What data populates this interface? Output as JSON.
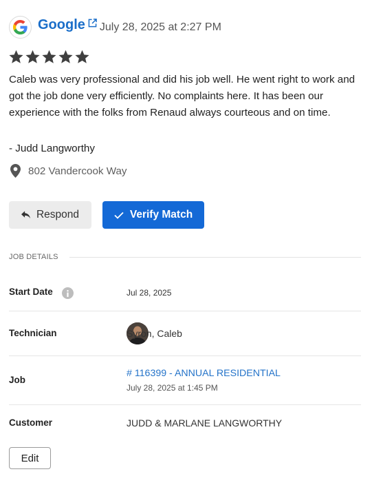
{
  "review": {
    "source": "Google",
    "date": "July 28, 2025 at 2:27 PM",
    "rating": 5,
    "text": "Caleb was very professional and did his job well. He went right to work and got the job done very efficiently. No complaints here. It has been our experience with the folks from Renaud always courteous and on time.",
    "reviewer": "- Judd Langworthy",
    "location": "802 Vandercook Way"
  },
  "actions": {
    "respond_label": "Respond",
    "verify_label": "Verify Match"
  },
  "job_details": {
    "title": "JOB DETAILS",
    "start_date_label": "Start Date",
    "start_date": "Jul 28, 2025",
    "technician_label": "Technician",
    "technician": "Syron, Caleb",
    "job_label": "Job",
    "job_link": "# 116399 - ANNUAL RESIDENTIAL",
    "job_datetime": "July 28, 2025 at 1:45 PM",
    "customer_label": "Customer",
    "customer": "JUDD & MARLANE LANGWORTHY",
    "edit_label": "Edit"
  },
  "colors": {
    "link_blue": "#1a6ec9",
    "primary_button": "#1469d6",
    "star": "#3f3f3f"
  },
  "icons": [
    "google-logo-icon",
    "external-link-icon",
    "star-icon",
    "map-pin-icon",
    "reply-icon",
    "check-icon",
    "info-icon"
  ]
}
